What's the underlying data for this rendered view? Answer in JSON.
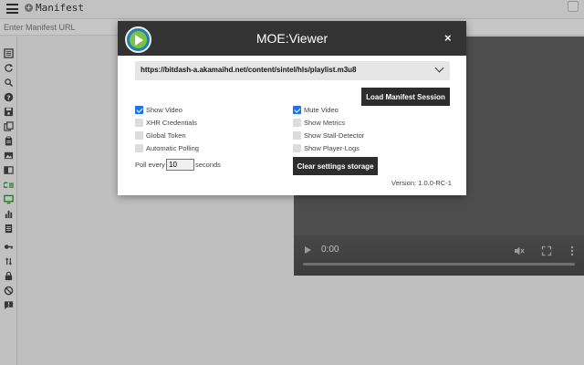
{
  "app": {
    "title": "Manifest",
    "url_placeholder": "Enter Manifest URL"
  },
  "sidebar": {
    "items": [
      {
        "icon": "manifest-list-icon"
      },
      {
        "icon": "refresh-icon"
      },
      {
        "icon": "search-icon"
      },
      {
        "icon": "help-icon"
      },
      {
        "icon": "save-icon"
      },
      {
        "icon": "copy-icon"
      },
      {
        "icon": "clipboard-icon"
      },
      {
        "icon": "images-icon"
      },
      {
        "icon": "columns-icon"
      },
      {
        "icon": "diff-icon"
      },
      {
        "icon": "monitor-icon"
      },
      {
        "icon": "bar-chart-icon"
      },
      {
        "icon": "document-icon"
      },
      {
        "icon": "key-icon"
      },
      {
        "icon": "sort-icon"
      },
      {
        "icon": "lock-icon"
      },
      {
        "icon": "block-icon"
      },
      {
        "icon": "comment-alert-icon"
      }
    ]
  },
  "video": {
    "time": "0:00",
    "progress": 0
  },
  "modal": {
    "title": "MOE:Viewer",
    "close_label": "×",
    "manifest_url": "https://bitdash-a.akamaihd.net/content/sintel/hls/playlist.m3u8",
    "load_button": "Load Manifest Session",
    "clear_button": "Clear settings storage",
    "version": "Version: 1.0.0-RC-1",
    "options_left": [
      {
        "label": "Show Video",
        "checked": true
      },
      {
        "label": "XHR Credentials",
        "checked": false
      },
      {
        "label": "Global Token",
        "checked": false
      },
      {
        "label": "Automatic Polling",
        "checked": false
      }
    ],
    "options_right": [
      {
        "label": "Mute Video",
        "checked": true
      },
      {
        "label": "Show Metrics",
        "checked": false
      },
      {
        "label": "Show Stall-Detector",
        "checked": false
      },
      {
        "label": "Show Player-Logs",
        "checked": false
      }
    ],
    "poll": {
      "prefix": "Poll every",
      "value": "10",
      "suffix": "seconds"
    }
  },
  "colors": {
    "header_bg": "#333333",
    "button_bg": "#2d2d2d",
    "checkbox_checked": "#1a73e8",
    "logo_blue": "#1f7fb6",
    "logo_green": "#7cc243",
    "video_bg": "#5e5e5e"
  }
}
